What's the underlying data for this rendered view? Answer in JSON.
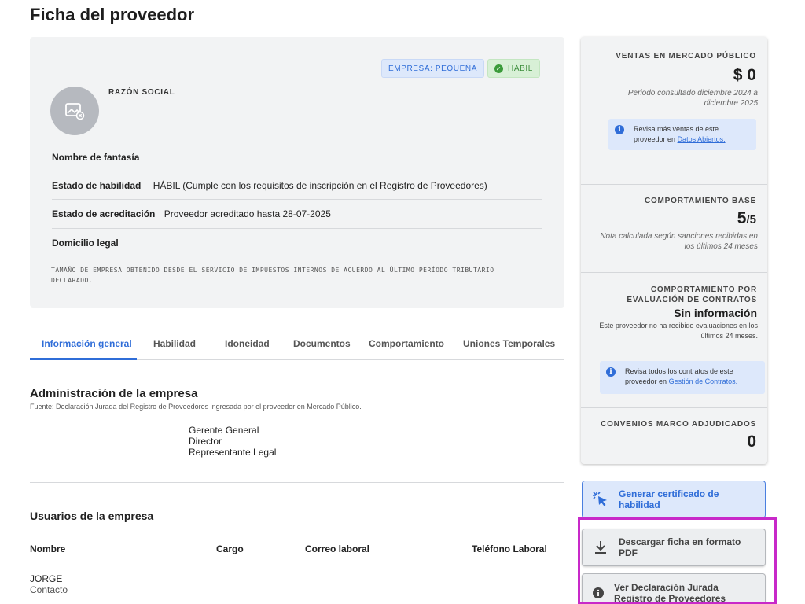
{
  "page_title": "Ficha del proveedor",
  "badges": {
    "size": "EMPRESA: PEQUEÑA",
    "status": "HÁBIL"
  },
  "razon_social_label": "RAZÓN SOCIAL",
  "fields": [
    {
      "label": "Nombre de fantasía",
      "value": ""
    },
    {
      "label": "Estado de habilidad",
      "value": "HÁBIL (Cumple con los requisitos de inscripción en el Registro de Proveedores)"
    },
    {
      "label": "Estado de acreditación",
      "value": "Proveedor acreditado hasta 28-07-2025"
    },
    {
      "label": "Domicilio legal",
      "value": ""
    }
  ],
  "size_note": "TAMAÑO DE EMPRESA OBTENIDO DESDE EL SERVICIO DE IMPUESTOS INTERNOS DE ACUERDO AL ÚLTIMO PERÍODO TRIBUTARIO DECLARADO.",
  "tabs": [
    "Información general",
    "Habilidad",
    "Idoneidad",
    "Documentos",
    "Comportamiento",
    "Uniones Temporales"
  ],
  "admin": {
    "title": "Administración de la empresa",
    "source": "Fuente: Declaración Jurada del Registro de Proveedores ingresada por el proveedor en Mercado Público.",
    "roles": [
      "Gerente General",
      "Director",
      "Representante Legal"
    ]
  },
  "users": {
    "title": "Usuarios de la empresa",
    "columns": [
      "Nombre",
      "Cargo",
      "Correo laboral",
      "Teléfono Laboral"
    ],
    "rows": [
      {
        "name": "JORGE",
        "role": "Contacto"
      }
    ]
  },
  "side": {
    "ventas": {
      "title": "VENTAS EN MERCADO PÚBLICO",
      "amount": "$ 0",
      "period": "Periodo consultado diciembre 2024 a diciembre 2025",
      "info_text": "Revisa más ventas de este proveedor en",
      "info_link": "Datos Abiertos."
    },
    "base": {
      "title": "COMPORTAMIENTO BASE",
      "score": "5",
      "score_max": "/5",
      "note": "Nota calculada según sanciones recibidas en los últimos 24 meses"
    },
    "eval": {
      "title": "COMPORTAMIENTO POR EVALUACIÓN DE CONTRATOS",
      "value": "Sin información",
      "note": "Este proveedor no ha recibido evaluaciones en los últimos 24 meses.",
      "info_text": "Revisa todos los contratos de este proveedor en",
      "info_link": "Gestión de Contratos."
    },
    "convenios": {
      "title": "CONVENIOS MARCO ADJUDICADOS",
      "value": "0"
    }
  },
  "buttons": {
    "certificado": "Generar certificado de habilidad",
    "descargar": "Descargar ficha en formato PDF",
    "declaracion": "Ver Declaración Jurada Registro de Proveedores"
  },
  "colors": {
    "accent": "#2f6dd8",
    "highlight": "#c829c9",
    "success": "#3b9b3a"
  },
  "icons": [
    "image-placeholder-icon",
    "check-circle-icon",
    "info-icon",
    "click-cursor-icon",
    "download-icon"
  ]
}
